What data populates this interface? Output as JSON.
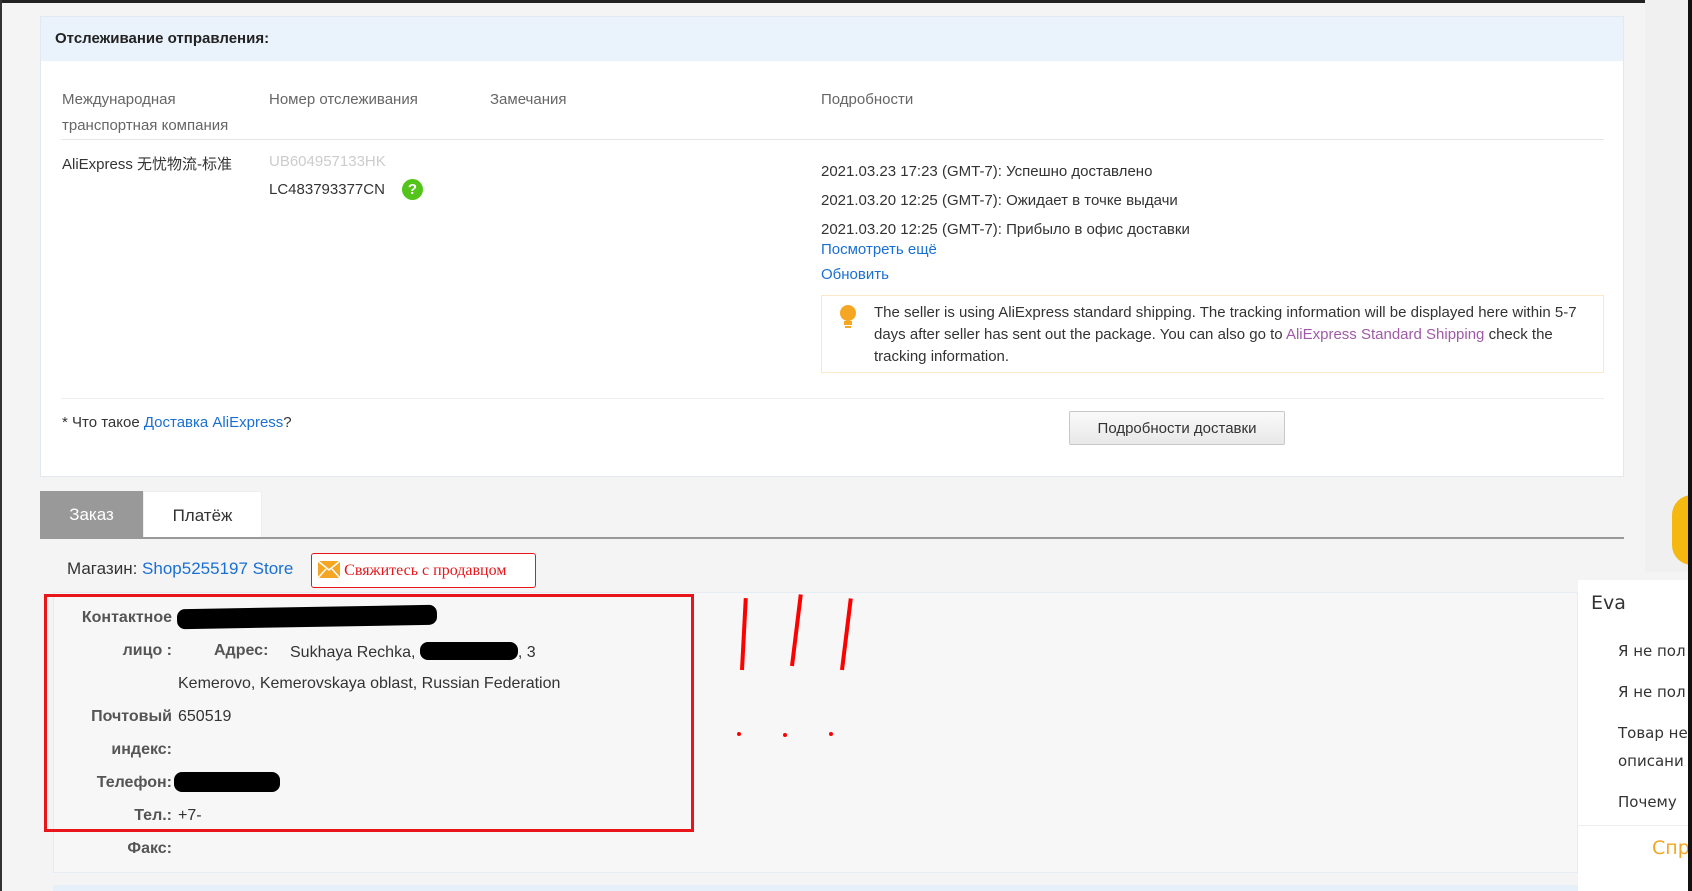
{
  "tracking": {
    "title": "Отслеживание отправления:",
    "columns": [
      "Международная",
      "транспортная компания",
      "Номер отслеживания",
      "Замечания",
      "Подробности"
    ],
    "carrier": "AliExpress 无忧物流-标准",
    "tracking_old": "UB604957133HK",
    "tracking_number": "LC483793377CN",
    "events": [
      "2021.03.23 17:23 (GMT-7): Успешно доставлено",
      "2021.03.20 12:25 (GMT-7): Ожидает в точке выдачи",
      "2021.03.20 12:25 (GMT-7): Прибыло в офис доставки"
    ],
    "see_more": "Посмотреть ещё",
    "refresh": "Обновить",
    "notice": {
      "text1": "The seller is using AliExpress standard shipping. The tracking information will be displayed here within 5-7 days after seller has sent out the package. You can also go to ",
      "link": "AliExpress Standard Shipping",
      "text2": " check the tracking information."
    },
    "footnote_prefix": "* Что такое ",
    "footnote_link": "Доставка AliExpress",
    "footnote_suffix": "?",
    "details_button": "Подробности доставки"
  },
  "tabs": [
    {
      "label": "Заказ",
      "active": true
    },
    {
      "label": "Платёж",
      "active": false
    }
  ],
  "store": {
    "label": "Магазин:",
    "name": "Shop5255197 Store",
    "contact": "Свяжитесь с продавцом"
  },
  "contact": {
    "contact_label_1": "Контактное",
    "contact_label_2": "лицо :",
    "address_label": "Адрес:",
    "address_1a": "Sukhaya Rechka,",
    "address_1b": ", 3",
    "address_2": "Kemerovo, Kemerovskaya oblast, Russian Federation",
    "zip_label_1": "Почтовый",
    "zip_label_2": "индекс:",
    "zip": "650519",
    "phone_label": "Телефон:",
    "tel_label": "Тел.:",
    "tel": "+7-",
    "fax_label": "Факс:"
  },
  "chat": {
    "name": "Eva",
    "items": [
      "Я не пол",
      "Я не пол",
      "Товар не",
      "описани",
      "Почему "
    ],
    "action": "Спр"
  },
  "colors": {
    "accent_link": "#1a6fd3",
    "annotation_red": "#e8161b",
    "tab_active": "#999999",
    "help_green": "#52c41a"
  }
}
